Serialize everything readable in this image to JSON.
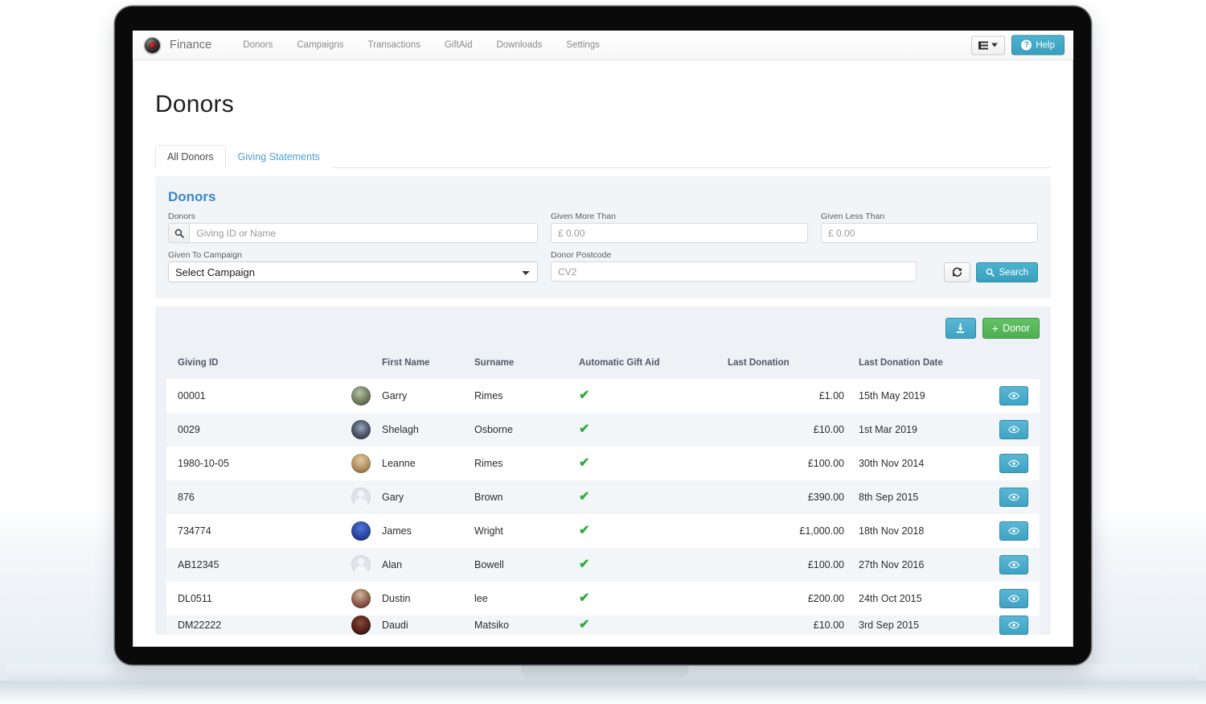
{
  "navbar": {
    "brand": "Finance",
    "logo_icon": "compass-logo-icon",
    "links": [
      "Donors",
      "Campaigns",
      "Transactions",
      "GiftAid",
      "Downloads",
      "Settings"
    ],
    "grid_button_icon": "list-grid-icon",
    "grid_button_caret": "chevron-down-icon",
    "help_label": "Help",
    "help_icon": "question-circle-icon",
    "help_color": "#3a9fbd"
  },
  "page": {
    "title": "Donors"
  },
  "tabs": [
    {
      "label": "All Donors",
      "active": true
    },
    {
      "label": "Giving Statements",
      "active": false
    }
  ],
  "filters": {
    "title": "Donors",
    "title_color": "#3a86c8",
    "donors": {
      "label": "Donors",
      "placeholder": "Giving ID or Name",
      "value": "",
      "icon": "search-icon"
    },
    "given_more_than": {
      "label": "Given More Than",
      "placeholder": "£ 0.00",
      "value": ""
    },
    "given_less_than": {
      "label": "Given Less Than",
      "placeholder": "£ 0.00",
      "value": ""
    },
    "given_to_campaign": {
      "label": "Given To Campaign",
      "selected": "Select Campaign",
      "options": [
        "Select Campaign"
      ]
    },
    "donor_postcode": {
      "label": "Donor Postcode",
      "placeholder": "CV2",
      "value": ""
    },
    "refresh_icon": "refresh-icon",
    "search_label": "Search",
    "search_icon": "search-icon"
  },
  "table_actions": {
    "download_icon": "download-icon",
    "download_color": "#3fa3c4",
    "add_label": "Donor",
    "add_icon": "plus-icon",
    "add_color": "#4caf50"
  },
  "table": {
    "headers": [
      "Giving ID",
      "",
      "First Name",
      "Surname",
      "Automatic Gift Aid",
      "Last Donation",
      "Last Donation Date",
      ""
    ],
    "row_action_icon": "eye-icon",
    "gift_aid_icon": "green-check-icon",
    "rows": [
      {
        "giving_id": "00001",
        "avatar": "photo",
        "first_name": "Garry",
        "surname": "Rimes",
        "gift_aid": "✔",
        "last_donation": "£1.00",
        "last_donation_date": "15th May 2019"
      },
      {
        "giving_id": "0029",
        "avatar": "photo",
        "first_name": "Shelagh",
        "surname": "Osborne",
        "gift_aid": "✔",
        "last_donation": "£10.00",
        "last_donation_date": "1st Mar 2019"
      },
      {
        "giving_id": "1980-10-05",
        "avatar": "photo",
        "first_name": "Leanne",
        "surname": "Rimes",
        "gift_aid": "✔",
        "last_donation": "£100.00",
        "last_donation_date": "30th Nov 2014"
      },
      {
        "giving_id": "876",
        "avatar": "blank",
        "first_name": "Gary",
        "surname": "Brown",
        "gift_aid": "✔",
        "last_donation": "£390.00",
        "last_donation_date": "8th Sep 2015"
      },
      {
        "giving_id": "734774",
        "avatar": "photo",
        "first_name": "James",
        "surname": "Wright",
        "gift_aid": "✔",
        "last_donation": "£1,000.00",
        "last_donation_date": "18th Nov 2018"
      },
      {
        "giving_id": "AB12345",
        "avatar": "blank",
        "first_name": "Alan",
        "surname": "Bowell",
        "gift_aid": "✔",
        "last_donation": "£100.00",
        "last_donation_date": "27th Nov 2016"
      },
      {
        "giving_id": "DL0511",
        "avatar": "photo",
        "first_name": "Dustin",
        "surname": "lee",
        "gift_aid": "✔",
        "last_donation": "£200.00",
        "last_donation_date": "24th Oct 2015"
      },
      {
        "giving_id": "DM22222",
        "avatar": "photo",
        "first_name": "Daudi",
        "surname": "Matsiko",
        "gift_aid": "✔",
        "last_donation": "£10.00",
        "last_donation_date": "3rd Sep 2015"
      }
    ]
  }
}
